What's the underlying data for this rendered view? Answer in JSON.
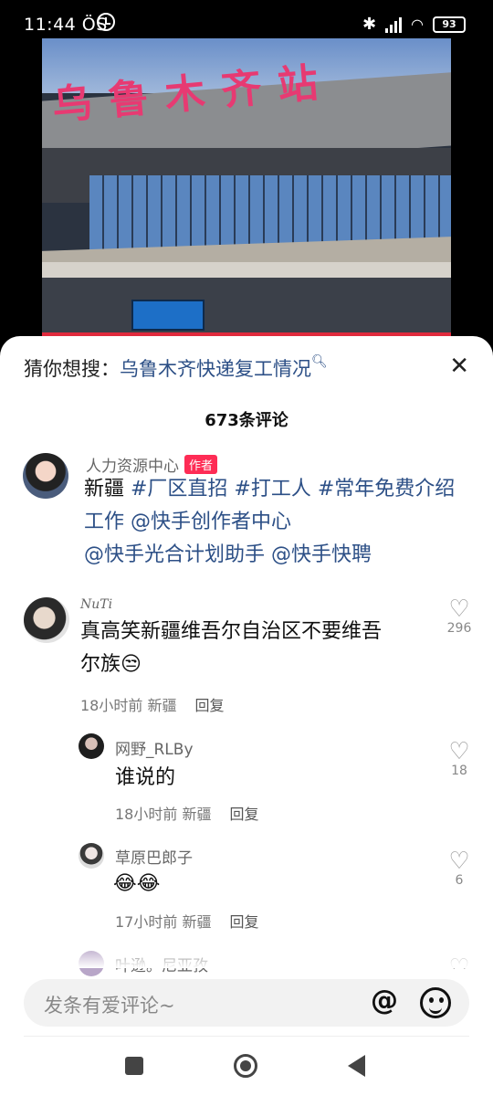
{
  "status_bar": {
    "time": "11:44 ÖS",
    "battery": "93"
  },
  "video": {
    "station_sign": "乌鲁木齐站"
  },
  "search_suggestion": {
    "prefix": "猜你想搜：",
    "query": "乌鲁木齐快递复工情况",
    "search_icon": "search-icon",
    "close_icon": "close-icon"
  },
  "comments_header": {
    "count": "673条评论"
  },
  "author_post": {
    "name": "人力资源中心",
    "badge": "作者",
    "line1_prefix": "新疆 ",
    "line1_tags": "#厂区直招 #打工人 #常年免费介绍",
    "line2": "工作 @快手创作者中心",
    "line3": "@快手光合计划助手 @快手快聘"
  },
  "comments": [
    {
      "name": "NuTi",
      "text_line1": "真高笑新疆维吾尔自治区不要维吾",
      "text_line2": "尔族😒",
      "time_location": "18小时前 新疆",
      "reply": "回复",
      "likes": "296"
    },
    {
      "name": "网野_RLBy",
      "text": "谁说的",
      "time_location": "18小时前 新疆",
      "reply": "回复",
      "likes": "18"
    },
    {
      "name": "草原巴郎子",
      "text": "😂😂",
      "time_location": "17小时前 新疆",
      "reply": "回复",
      "likes": "6"
    },
    {
      "name": "叶逊。尼亚孜"
    }
  ],
  "input": {
    "placeholder": "发条有爱评论~",
    "at_label": "@"
  },
  "colors": {
    "link": "#2c4f86",
    "badge": "#fe2c55",
    "video_bar": "#e02a3d"
  }
}
